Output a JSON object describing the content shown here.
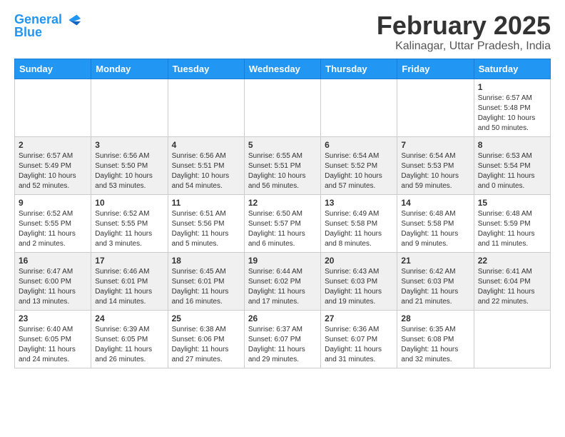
{
  "header": {
    "logo_line1": "General",
    "logo_line2": "Blue",
    "month_title": "February 2025",
    "subtitle": "Kalinagar, Uttar Pradesh, India"
  },
  "days_of_week": [
    "Sunday",
    "Monday",
    "Tuesday",
    "Wednesday",
    "Thursday",
    "Friday",
    "Saturday"
  ],
  "weeks": [
    {
      "row_style": "odd",
      "days": [
        {
          "num": "",
          "info": ""
        },
        {
          "num": "",
          "info": ""
        },
        {
          "num": "",
          "info": ""
        },
        {
          "num": "",
          "info": ""
        },
        {
          "num": "",
          "info": ""
        },
        {
          "num": "",
          "info": ""
        },
        {
          "num": "1",
          "info": "Sunrise: 6:57 AM\nSunset: 5:48 PM\nDaylight: 10 hours\nand 50 minutes."
        }
      ]
    },
    {
      "row_style": "even",
      "days": [
        {
          "num": "2",
          "info": "Sunrise: 6:57 AM\nSunset: 5:49 PM\nDaylight: 10 hours\nand 52 minutes."
        },
        {
          "num": "3",
          "info": "Sunrise: 6:56 AM\nSunset: 5:50 PM\nDaylight: 10 hours\nand 53 minutes."
        },
        {
          "num": "4",
          "info": "Sunrise: 6:56 AM\nSunset: 5:51 PM\nDaylight: 10 hours\nand 54 minutes."
        },
        {
          "num": "5",
          "info": "Sunrise: 6:55 AM\nSunset: 5:51 PM\nDaylight: 10 hours\nand 56 minutes."
        },
        {
          "num": "6",
          "info": "Sunrise: 6:54 AM\nSunset: 5:52 PM\nDaylight: 10 hours\nand 57 minutes."
        },
        {
          "num": "7",
          "info": "Sunrise: 6:54 AM\nSunset: 5:53 PM\nDaylight: 10 hours\nand 59 minutes."
        },
        {
          "num": "8",
          "info": "Sunrise: 6:53 AM\nSunset: 5:54 PM\nDaylight: 11 hours\nand 0 minutes."
        }
      ]
    },
    {
      "row_style": "odd",
      "days": [
        {
          "num": "9",
          "info": "Sunrise: 6:52 AM\nSunset: 5:55 PM\nDaylight: 11 hours\nand 2 minutes."
        },
        {
          "num": "10",
          "info": "Sunrise: 6:52 AM\nSunset: 5:55 PM\nDaylight: 11 hours\nand 3 minutes."
        },
        {
          "num": "11",
          "info": "Sunrise: 6:51 AM\nSunset: 5:56 PM\nDaylight: 11 hours\nand 5 minutes."
        },
        {
          "num": "12",
          "info": "Sunrise: 6:50 AM\nSunset: 5:57 PM\nDaylight: 11 hours\nand 6 minutes."
        },
        {
          "num": "13",
          "info": "Sunrise: 6:49 AM\nSunset: 5:58 PM\nDaylight: 11 hours\nand 8 minutes."
        },
        {
          "num": "14",
          "info": "Sunrise: 6:48 AM\nSunset: 5:58 PM\nDaylight: 11 hours\nand 9 minutes."
        },
        {
          "num": "15",
          "info": "Sunrise: 6:48 AM\nSunset: 5:59 PM\nDaylight: 11 hours\nand 11 minutes."
        }
      ]
    },
    {
      "row_style": "even",
      "days": [
        {
          "num": "16",
          "info": "Sunrise: 6:47 AM\nSunset: 6:00 PM\nDaylight: 11 hours\nand 13 minutes."
        },
        {
          "num": "17",
          "info": "Sunrise: 6:46 AM\nSunset: 6:01 PM\nDaylight: 11 hours\nand 14 minutes."
        },
        {
          "num": "18",
          "info": "Sunrise: 6:45 AM\nSunset: 6:01 PM\nDaylight: 11 hours\nand 16 minutes."
        },
        {
          "num": "19",
          "info": "Sunrise: 6:44 AM\nSunset: 6:02 PM\nDaylight: 11 hours\nand 17 minutes."
        },
        {
          "num": "20",
          "info": "Sunrise: 6:43 AM\nSunset: 6:03 PM\nDaylight: 11 hours\nand 19 minutes."
        },
        {
          "num": "21",
          "info": "Sunrise: 6:42 AM\nSunset: 6:03 PM\nDaylight: 11 hours\nand 21 minutes."
        },
        {
          "num": "22",
          "info": "Sunrise: 6:41 AM\nSunset: 6:04 PM\nDaylight: 11 hours\nand 22 minutes."
        }
      ]
    },
    {
      "row_style": "odd",
      "days": [
        {
          "num": "23",
          "info": "Sunrise: 6:40 AM\nSunset: 6:05 PM\nDaylight: 11 hours\nand 24 minutes."
        },
        {
          "num": "24",
          "info": "Sunrise: 6:39 AM\nSunset: 6:05 PM\nDaylight: 11 hours\nand 26 minutes."
        },
        {
          "num": "25",
          "info": "Sunrise: 6:38 AM\nSunset: 6:06 PM\nDaylight: 11 hours\nand 27 minutes."
        },
        {
          "num": "26",
          "info": "Sunrise: 6:37 AM\nSunset: 6:07 PM\nDaylight: 11 hours\nand 29 minutes."
        },
        {
          "num": "27",
          "info": "Sunrise: 6:36 AM\nSunset: 6:07 PM\nDaylight: 11 hours\nand 31 minutes."
        },
        {
          "num": "28",
          "info": "Sunrise: 6:35 AM\nSunset: 6:08 PM\nDaylight: 11 hours\nand 32 minutes."
        },
        {
          "num": "",
          "info": ""
        }
      ]
    }
  ]
}
